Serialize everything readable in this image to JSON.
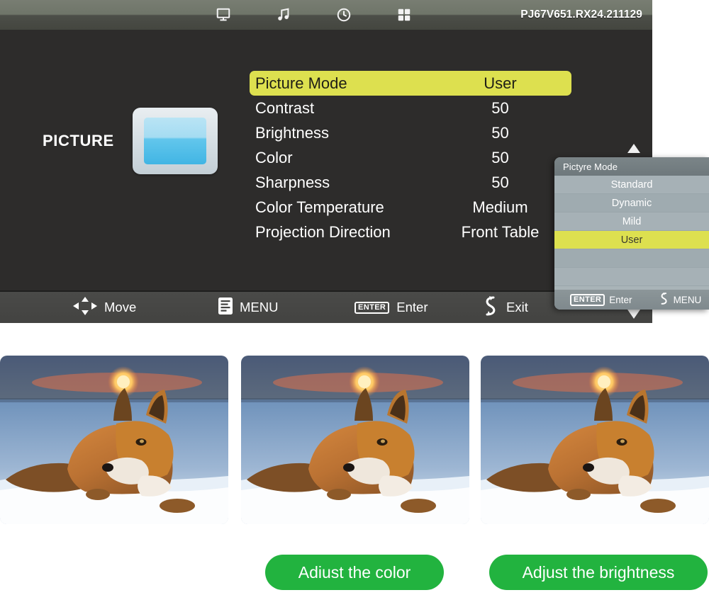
{
  "osd": {
    "topbar": {
      "icons": [
        {
          "name": "display-icon",
          "glyph": "display"
        },
        {
          "name": "music-icon",
          "glyph": "music"
        },
        {
          "name": "clock-icon",
          "glyph": "clock"
        },
        {
          "name": "apps-grid-icon",
          "glyph": "grid"
        }
      ],
      "model": "PJ67V651.RX24.211129"
    },
    "category": {
      "label": "PICTURE",
      "icon": "picture-screen-icon"
    },
    "menu": {
      "rows": [
        {
          "label": "Picture Mode",
          "value": "User",
          "selected": true
        },
        {
          "label": "Contrast",
          "value": "50",
          "selected": false
        },
        {
          "label": "Brightness",
          "value": "50",
          "selected": false
        },
        {
          "label": "Color",
          "value": "50",
          "selected": false
        },
        {
          "label": "Sharpness",
          "value": "50",
          "selected": false
        },
        {
          "label": "Color Temperature",
          "value": "Medium",
          "selected": false
        },
        {
          "label": "Projection Direction",
          "value": "Front Table",
          "selected": false
        }
      ]
    },
    "bottombar": {
      "move": "Move",
      "menu": "MENU",
      "enter_key": "ENTER",
      "enter": "Enter",
      "exit": "Exit"
    }
  },
  "popup": {
    "title": "Pictyre Mode",
    "options": [
      {
        "label": "Standard",
        "selected": false
      },
      {
        "label": "Dynamic",
        "selected": false
      },
      {
        "label": "Mild",
        "selected": false
      },
      {
        "label": "User",
        "selected": true
      },
      {
        "label": "",
        "selected": false
      },
      {
        "label": "",
        "selected": false
      }
    ],
    "footer": {
      "enter_key": "ENTER",
      "enter": "Enter",
      "menu": "MENU"
    }
  },
  "photos": [
    {
      "alt": "fox-on-snow-at-sunset-1"
    },
    {
      "alt": "fox-on-snow-at-sunset-2"
    },
    {
      "alt": "fox-on-snow-at-sunset-3"
    }
  ],
  "cta": {
    "color": "Adiust the color",
    "brightness": "Adjust the brightness"
  },
  "colors": {
    "highlight_yellow": "#dde04f",
    "cta_green": "#22b33f",
    "osd_background": "#2d2c2b",
    "topbar_gray": "#6f7569",
    "popup_gray": "#a6b1b6"
  }
}
